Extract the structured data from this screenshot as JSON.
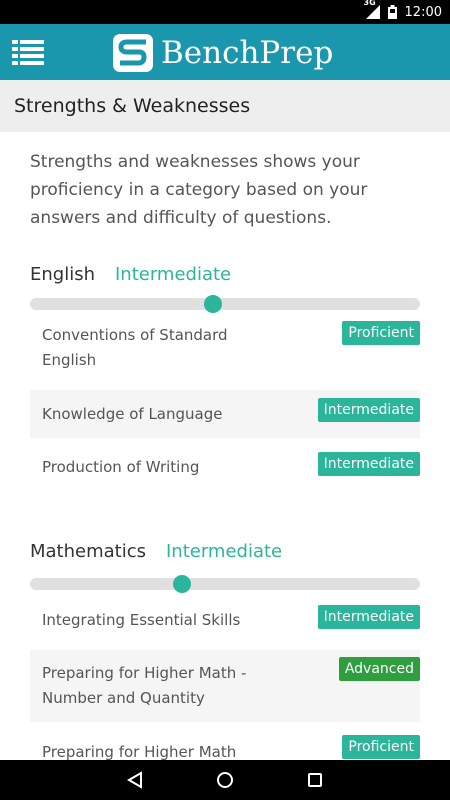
{
  "status_bar": {
    "network": "3G",
    "time": "12:00"
  },
  "app": {
    "brand": "BenchPrep"
  },
  "header": {
    "title": "Strengths & Weaknesses"
  },
  "intro": "Strengths and weaknesses shows your proficiency in a category based on your answers and difficulty of questions.",
  "categories": [
    {
      "title": "English",
      "level": "Intermediate",
      "proficiency": 0.47,
      "items": [
        {
          "label": "Conventions of Standard English",
          "badge": "Proficient"
        },
        {
          "label": "Knowledge of Language",
          "badge": "Intermediate"
        },
        {
          "label": "Production of Writing",
          "badge": "Intermediate"
        }
      ]
    },
    {
      "title": "Mathematics",
      "level": "Intermediate",
      "proficiency": 0.39,
      "items": [
        {
          "label": "Integrating Essential Skills",
          "badge": "Intermediate"
        },
        {
          "label": "Preparing for Higher Math - Number and Quantity",
          "badge": "Advanced"
        },
        {
          "label": "Preparing for Higher Math",
          "badge": "Proficient"
        }
      ]
    }
  ],
  "colors": {
    "app_bar": "#1b97ad",
    "accent": "#2bb59a",
    "advanced": "#2e9e3f"
  },
  "icons": {
    "menu": "list-menu-icon",
    "back": "back-triangle-icon",
    "home": "home-circle-icon",
    "recents": "recents-square-icon"
  }
}
